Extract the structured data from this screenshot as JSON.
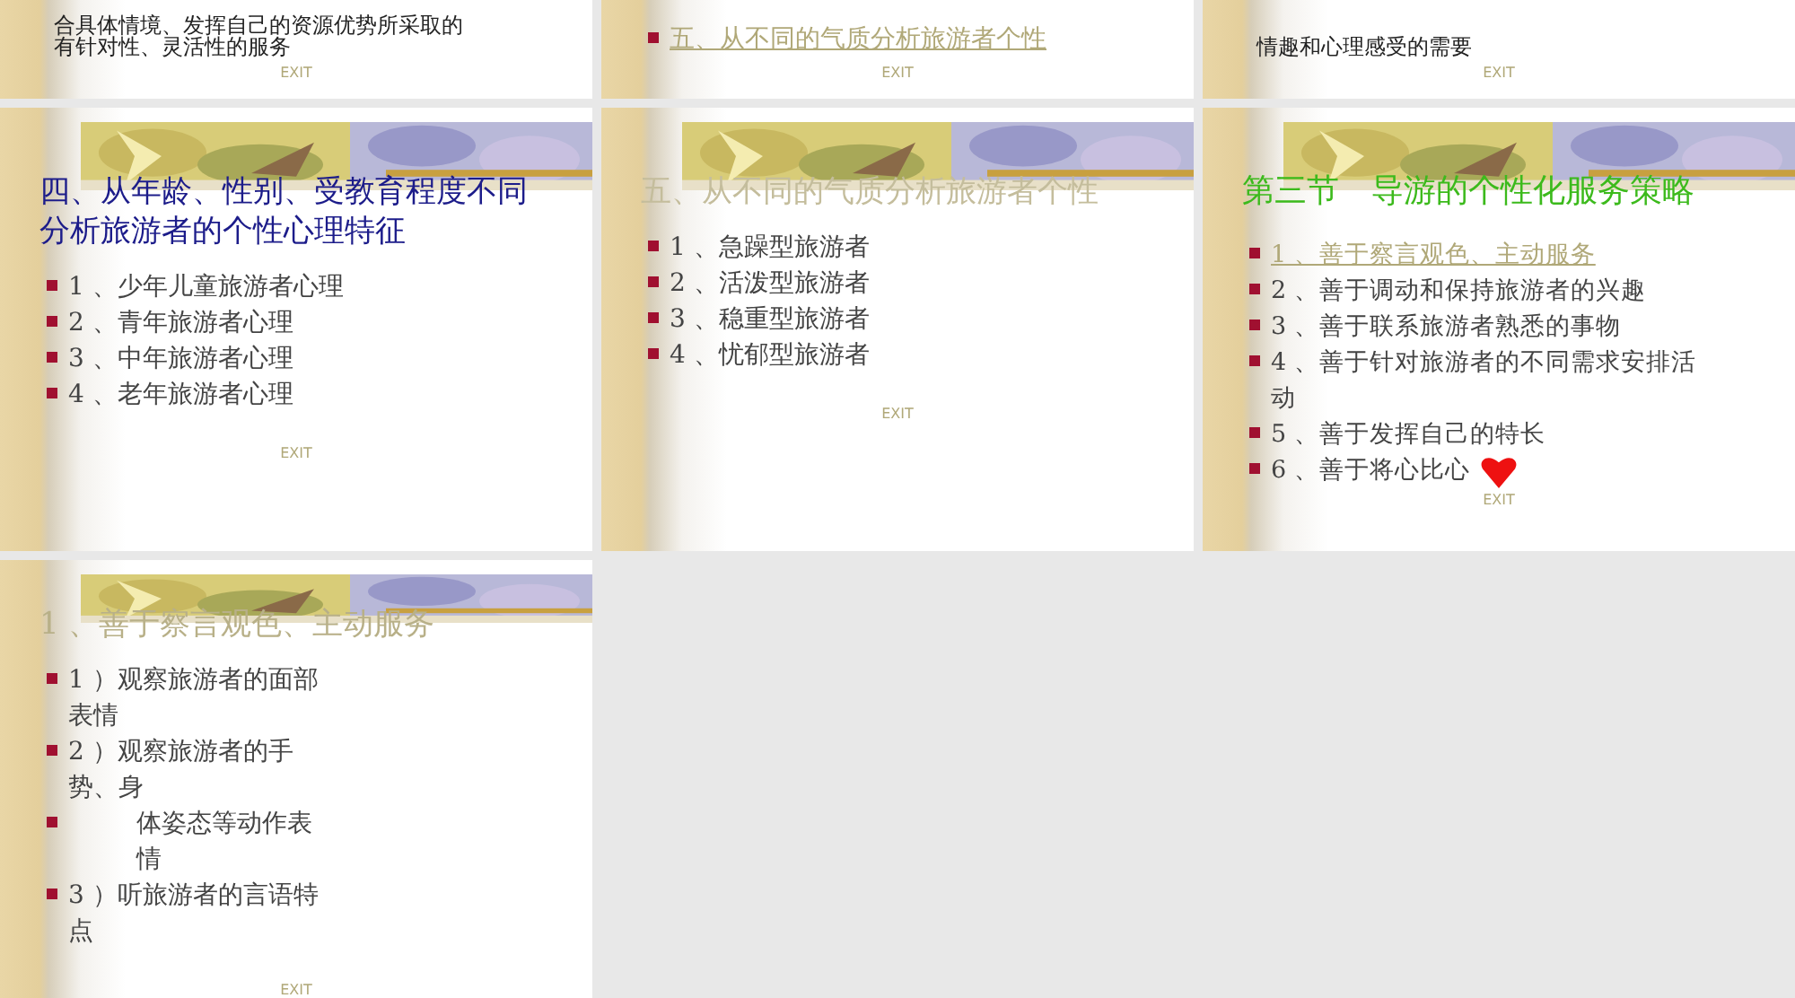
{
  "slides": [
    {
      "lines": [
        "合具体情境、发挥自己的资源优势所采取的",
        "有针对性、灵活性的服务"
      ],
      "exit": "EXIT"
    },
    {
      "bullets": [
        {
          "text": "五、从不同的气质分析旅游者个性",
          "link": true
        }
      ],
      "exit": "EXIT"
    },
    {
      "lines": [
        "情趣和心理感受的需要"
      ],
      "exit": "EXIT"
    },
    {
      "title": {
        "text": "四、从年龄、性别、受教育程度不同分析旅游者的个性心理特征",
        "color": "#1c1c8a"
      },
      "bullets": [
        {
          "text": "1 、少年儿童旅游者心理",
          "link": false
        },
        {
          "text": "2 、青年旅游者心理",
          "link": false
        },
        {
          "text": "3 、中年旅游者心理",
          "link": false
        },
        {
          "text": "4 、老年旅游者心理",
          "link": false
        }
      ],
      "exit": "EXIT"
    },
    {
      "title": {
        "text": "五、从不同的气质分析旅游者个性",
        "color": "#c4bd9c"
      },
      "bullets": [
        {
          "text": "1 、急躁型旅游者",
          "link": false
        },
        {
          "text": "2 、活泼型旅游者",
          "link": false
        },
        {
          "text": "3 、稳重型旅游者",
          "link": false
        },
        {
          "text": "4 、忧郁型旅游者",
          "link": false
        }
      ],
      "exit": "EXIT"
    },
    {
      "title": {
        "text": "第三节　导游的个性化服务策略",
        "color": "#3cba1c"
      },
      "bullets": [
        {
          "text": "1 、善于察言观色、主动服务",
          "link": true
        },
        {
          "text": "2 、善于调动和保持旅游者的兴趣",
          "link": false
        },
        {
          "text": "3 、善于联系旅游者熟悉的事物",
          "link": false
        },
        {
          "text": "4 、善于针对旅游者的不同需求安排活动",
          "link": false
        },
        {
          "text": "5 、善于发挥自己的特长",
          "link": false
        },
        {
          "text": "6 、善于将心比心",
          "link": false,
          "heart": true
        }
      ],
      "exit": "EXIT"
    },
    {
      "title": {
        "text": "1 、善于察言观色、主动服务",
        "color": "#b8b088"
      },
      "bullets": [
        {
          "text": "1 ）观察旅游者的面部表情",
          "link": false
        },
        {
          "text": "2 ）观察旅游者的手势、身",
          "link": false
        },
        {
          "text": "体姿态等动作表情",
          "link": false,
          "indent": true
        },
        {
          "text": "3 ）听旅游者的言语特点",
          "link": false
        }
      ],
      "exit": "EXIT"
    }
  ]
}
